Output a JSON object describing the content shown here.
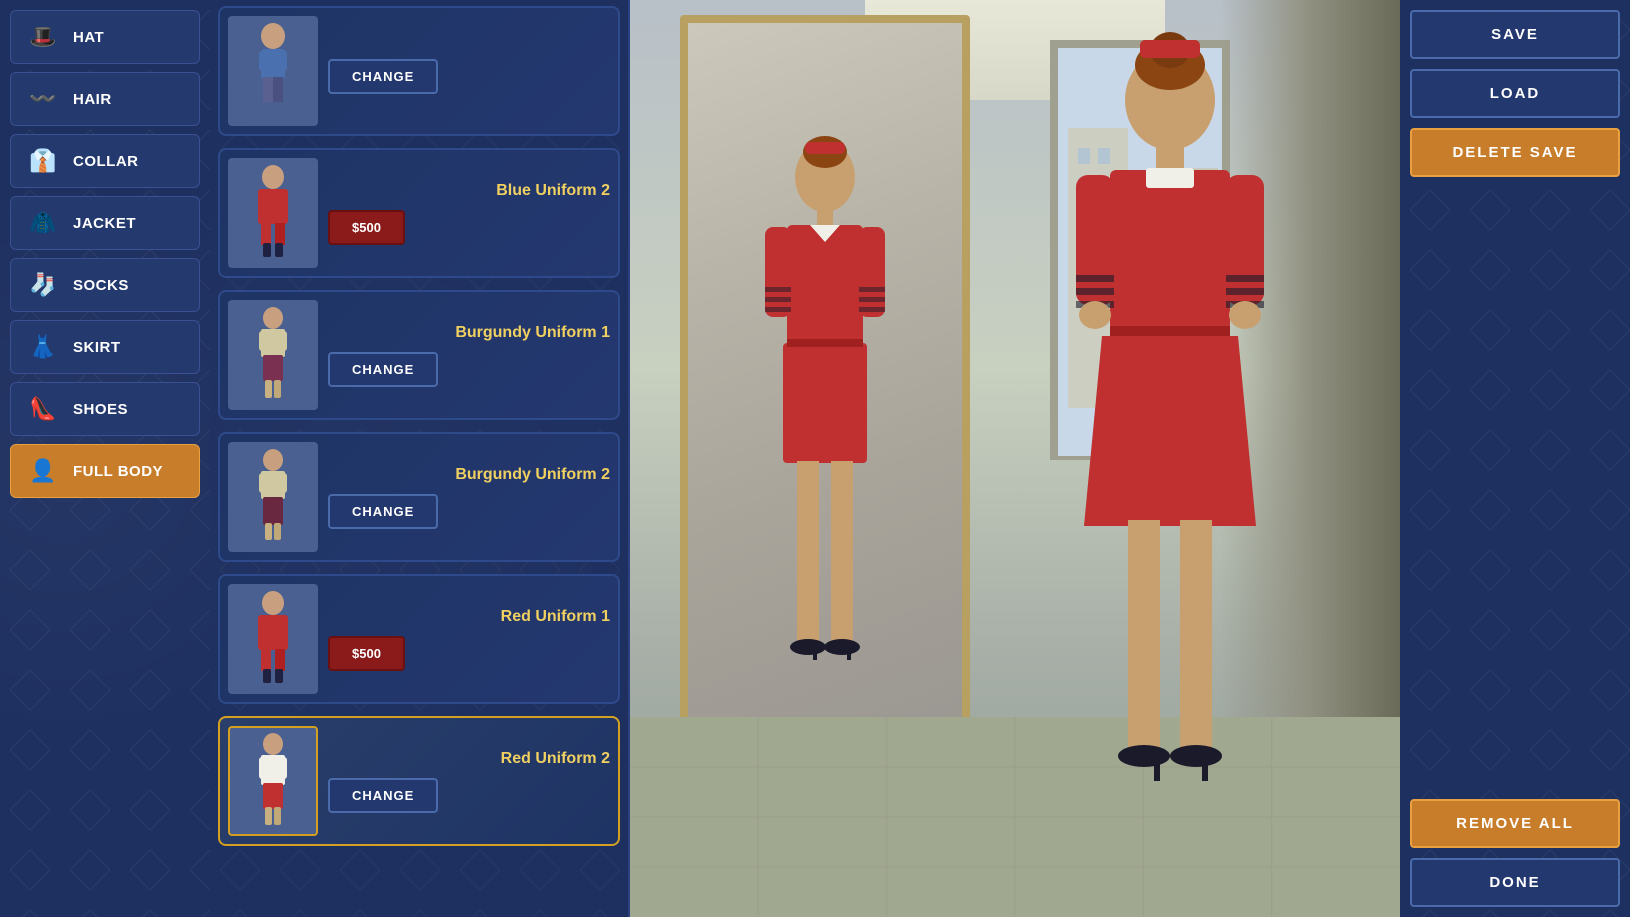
{
  "sidebar": {
    "items": [
      {
        "id": "hat",
        "label": "Hat",
        "icon": "🎩"
      },
      {
        "id": "hair",
        "label": "Hair",
        "icon": "〰"
      },
      {
        "id": "collar",
        "label": "Collar",
        "icon": "👔"
      },
      {
        "id": "jacket",
        "label": "Jacket",
        "icon": "🧥"
      },
      {
        "id": "socks",
        "label": "Socks",
        "icon": "🧦"
      },
      {
        "id": "skirt",
        "label": "Skirt",
        "icon": "👗"
      },
      {
        "id": "shoes",
        "label": "Shoes",
        "icon": "👠"
      },
      {
        "id": "full-body",
        "label": "Full Body",
        "icon": "👤",
        "active": true
      }
    ]
  },
  "clothing_list": {
    "items": [
      {
        "id": "item-top",
        "name": "",
        "button_type": "change",
        "button_label": "CHANGE",
        "selected": false,
        "figure_color": "blue"
      },
      {
        "id": "blue-uniform-2",
        "name": "Blue Uniform 2",
        "button_type": "price",
        "button_label": "$500",
        "selected": false,
        "figure_color": "blue"
      },
      {
        "id": "burgundy-uniform-1",
        "name": "Burgundy Uniform 1",
        "button_type": "change",
        "button_label": "CHANGE",
        "selected": false,
        "figure_color": "burgundy"
      },
      {
        "id": "burgundy-uniform-2",
        "name": "Burgundy Uniform 2",
        "button_type": "change",
        "button_label": "CHANGE",
        "selected": false,
        "figure_color": "burgundy"
      },
      {
        "id": "red-uniform-1",
        "name": "Red Uniform 1",
        "button_type": "price",
        "button_label": "$500",
        "selected": false,
        "figure_color": "red"
      },
      {
        "id": "red-uniform-2",
        "name": "Red Uniform 2",
        "button_type": "change",
        "button_label": "CHANGE",
        "selected": true,
        "figure_color": "red"
      }
    ]
  },
  "right_panel": {
    "save_label": "SAVE",
    "load_label": "LOAD",
    "delete_save_label": "DELETE SAVE",
    "remove_all_label": "REMOVE ALL",
    "done_label": "DONE"
  }
}
